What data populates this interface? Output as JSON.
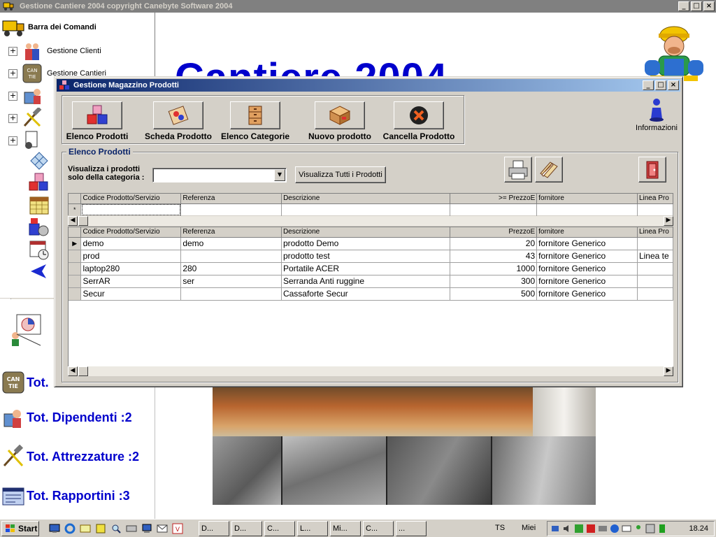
{
  "main_window": {
    "title": "Gestione Cantiere 2004    copyright Canebyte Software 2004",
    "big_title": "Cantiere 2004",
    "controls": {
      "minimize": "_",
      "maximize": "□",
      "close": "×"
    }
  },
  "tree": {
    "header": "Barra dei Comandi",
    "items": [
      {
        "label": "Gestione Clienti",
        "icon": "clients-icon"
      },
      {
        "label": "Gestione Cantieri",
        "icon": "sites-icon"
      },
      {
        "label": "",
        "icon": "employees-icon"
      },
      {
        "label": "",
        "icon": "tools-icon"
      },
      {
        "label": "",
        "icon": "reports-icon"
      }
    ],
    "expander": "+"
  },
  "stats": [
    {
      "label": "Tot.",
      "icon": "sites-icon"
    },
    {
      "label": "Tot. Dipendenti :2",
      "icon": "employees-icon"
    },
    {
      "label": "Tot. Attrezzature :2",
      "icon": "tools-icon"
    },
    {
      "label": "Tot. Rapportini :3",
      "icon": "reports-icon"
    }
  ],
  "dialog": {
    "title": "Gestione Magazzino Prodotti",
    "toolbar": [
      {
        "label": "Elenco Prodotti",
        "icon": "cubes-icon"
      },
      {
        "label": "Scheda Prodotto",
        "icon": "product-card-icon"
      },
      {
        "label": "Elenco Categorie",
        "icon": "cabinet-icon"
      },
      {
        "label": "Nuovo prodotto",
        "icon": "box-icon"
      },
      {
        "label": "Cancella Prodotto",
        "icon": "delete-icon"
      }
    ],
    "info_label": "Informazioni",
    "group_title": "Elenco Prodotti",
    "filter_label_line1": "Visualizza i prodotti",
    "filter_label_line2": "solo della categoria :",
    "category_value": "",
    "show_all_label": "Visualizza Tutti i Prodotti",
    "search_grid": {
      "columns": [
        "Codice Prodotto/Servizio",
        "Referenza",
        "Descrizione",
        ">= PrezzoE",
        "fornitore",
        "Linea Pro"
      ],
      "new_row_marker": "*"
    },
    "products_grid": {
      "columns": [
        "Codice Prodotto/Servizio",
        "Referenza",
        "Descrizione",
        "PrezzoE",
        "fornitore",
        "Linea Pro"
      ],
      "current_row_marker": "▶",
      "rows": [
        {
          "codice": "demo",
          "referenza": "demo",
          "descrizione": "prodotto Demo",
          "prezzo": "20",
          "fornitore": "fornitore Generico",
          "linea": ""
        },
        {
          "codice": "prod",
          "referenza": "",
          "descrizione": "prodotto test",
          "prezzo": "43",
          "fornitore": "fornitore Generico",
          "linea": "Linea te"
        },
        {
          "codice": "laptop280",
          "referenza": "280",
          "descrizione": "Portatile ACER",
          "prezzo": "1000",
          "fornitore": "fornitore Generico",
          "linea": ""
        },
        {
          "codice": "SerrAR",
          "referenza": "ser",
          "descrizione": "Serranda Anti ruggine",
          "prezzo": "300",
          "fornitore": "fornitore Generico",
          "linea": ""
        },
        {
          "codice": "Secur",
          "referenza": "",
          "descrizione": "Cassaforte Secur",
          "prezzo": "500",
          "fornitore": "fornitore Generico",
          "linea": ""
        }
      ]
    }
  },
  "taskbar": {
    "start_label": "Start",
    "tasks": [
      "D...",
      "D...",
      "C...",
      "L...",
      "Mi...",
      "C...",
      "..."
    ],
    "ts_label": "TS",
    "miei_label": "Miei",
    "clock": "18.24"
  }
}
